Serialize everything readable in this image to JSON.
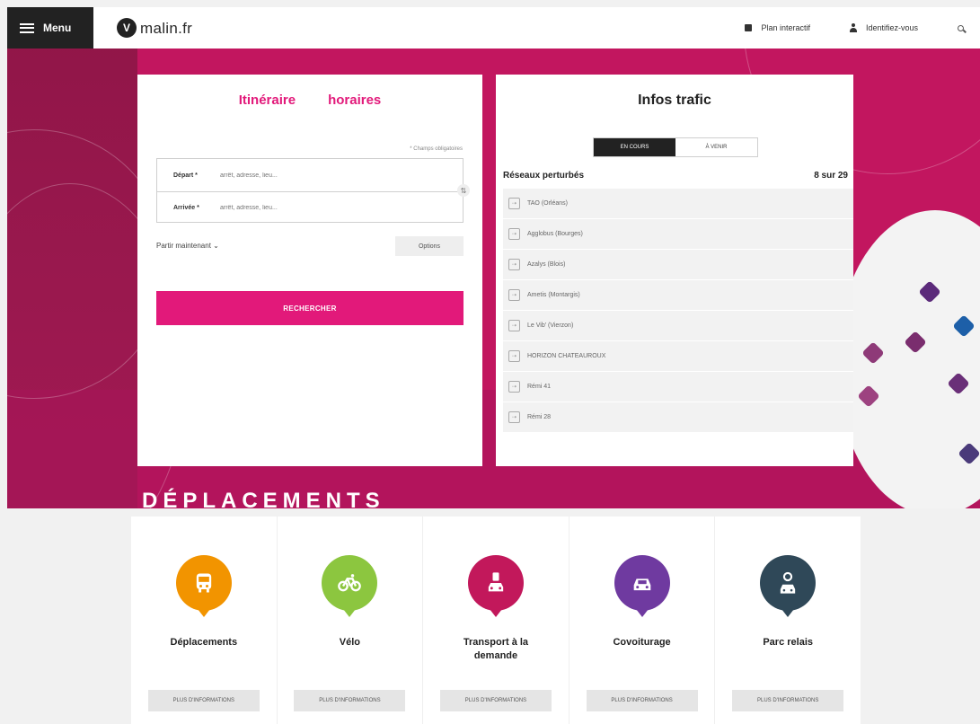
{
  "topbar": {
    "menu_label": "Menu",
    "logo_mark": "V",
    "logo_name": "malin.fr",
    "logo_tagline": "",
    "map_link": "Plan interactif",
    "login_link": "Identifiez-vous"
  },
  "itinerary": {
    "tab_itinerary": "Itinéraire",
    "tab_schedules": "horaires",
    "mandatory_note": "* Champs obligatoires",
    "depart_label": "Départ *",
    "depart_placeholder": "arrêt, adresse, lieu...",
    "arrival_label": "Arrivée *",
    "arrival_placeholder": "arrêt, adresse, lieu...",
    "depart_time": "Partir maintenant",
    "options_label": "Options",
    "search_label": "RECHERCHER"
  },
  "traffic": {
    "title": "Infos trafic",
    "toggle_current": "EN COURS",
    "toggle_upcoming": "À VENIR",
    "networks_label": "Réseaux perturbés",
    "networks_count": "8 sur 29",
    "networks": [
      "TAO (Orléans)",
      "Agglobus (Bourges)",
      "Azalys (Blois)",
      "Ametis (Montargis)",
      "Le Vib' (Vierzon)",
      "HORIZON CHATEAUROUX",
      "Rémi 41",
      "Rémi 28"
    ]
  },
  "section": {
    "title": "DÉPLACEMENTS"
  },
  "services": [
    {
      "label": "Déplacements",
      "sub": "",
      "button": "PLUS D'INFORMATIONS",
      "color": "#f29400",
      "icon": "bus-icon"
    },
    {
      "label": "Vélo",
      "sub": "",
      "button": "PLUS D'INFORMATIONS",
      "color": "#8cc63f",
      "icon": "bike-icon"
    },
    {
      "label": "Transport à la demande",
      "sub": "",
      "button": "PLUS D'INFORMATIONS",
      "color": "#c2185b",
      "icon": "phone-car-icon"
    },
    {
      "label": "Covoiturage",
      "sub": "",
      "button": "PLUS D'INFORMATIONS",
      "color": "#6f3aa0",
      "icon": "carpool-icon"
    },
    {
      "label": "Parc relais",
      "sub": "",
      "button": "PLUS D'INFORMATIONS",
      "color": "#2f4858",
      "icon": "park-ride-icon"
    }
  ],
  "colors": {
    "brand_pink": "#e2197a",
    "hero_bg": "#c2165f",
    "dark": "#222222"
  }
}
